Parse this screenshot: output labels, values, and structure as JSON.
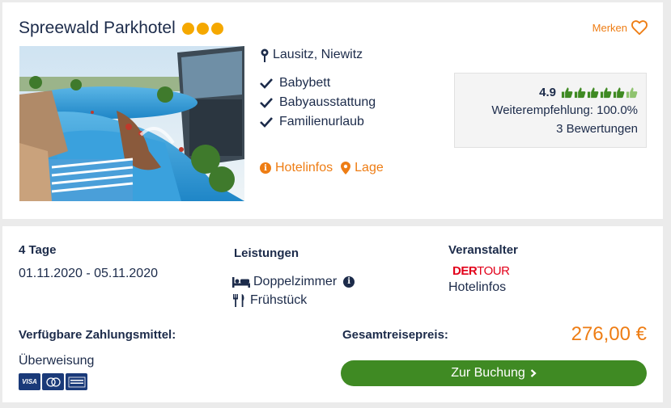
{
  "hotel": {
    "name": "Spreewald Parkhotel",
    "stars": 3,
    "save_label": "Merken",
    "location": "Lausitz, Niewitz",
    "features": [
      "Babybett",
      "Babyausstattung",
      "Familienurlaub"
    ],
    "links": {
      "info": "Hotelinfos",
      "map": "Lage"
    }
  },
  "rating": {
    "score": "4.9",
    "thumbs_filled": 5,
    "thumbs_total": 6,
    "recommendation": "Weiterempfehlung: 100.0%",
    "reviews": "3 Bewertungen"
  },
  "offer": {
    "duration": "4 Tage",
    "dates": "01.11.2020 - 05.11.2020",
    "services_heading": "Leistungen",
    "room": "Doppelzimmer",
    "board": "Frühstück",
    "operator_heading": "Veranstalter",
    "operator_logo": {
      "part1": "DER",
      "part2": "TOUR"
    },
    "operator_link": "Hotelinfos",
    "payment_heading": "Verfügbare Zahlungsmittel:",
    "payment_method": "Überweisung",
    "payment_icons": [
      "VISA",
      "Mastercard",
      "American Express"
    ],
    "total_label": "Gesamtreisepreis:",
    "price": "276,00 €",
    "book_label": "Zur Buchung"
  },
  "colors": {
    "accent": "#ee7d14",
    "navy": "#1c2b4a",
    "green": "#3f8a23",
    "star": "#f5a800"
  }
}
